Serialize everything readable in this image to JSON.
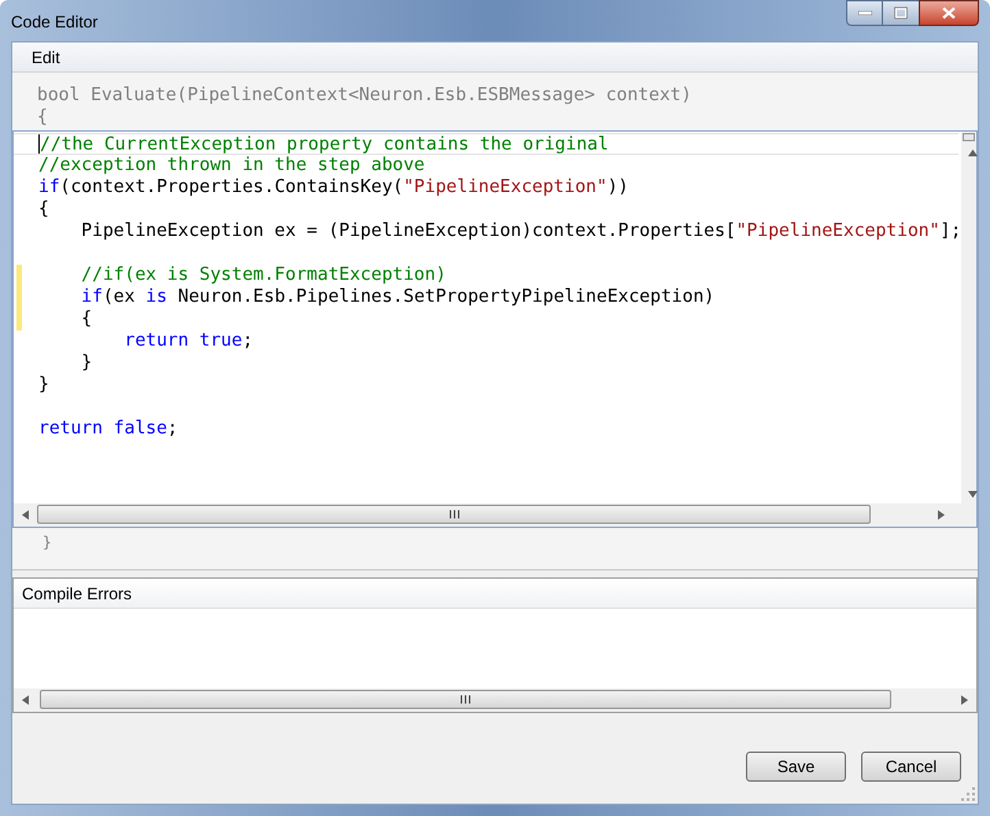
{
  "window": {
    "title": "Code Editor"
  },
  "menu": [
    {
      "label": "Edit"
    }
  ],
  "header_lines": [
    "bool Evaluate(PipelineContext<Neuron.Esb.ESBMessage> context)",
    "{"
  ],
  "code_lines": [
    {
      "current": true,
      "changed": false,
      "tokens": [
        {
          "kind": "comment",
          "text": "//the CurrentException property contains the original"
        }
      ]
    },
    {
      "current": false,
      "changed": false,
      "tokens": [
        {
          "kind": "comment",
          "text": "//exception thrown in the step above"
        }
      ]
    },
    {
      "current": false,
      "changed": false,
      "tokens": [
        {
          "kind": "keyword",
          "text": "if"
        },
        {
          "kind": "plain",
          "text": "(context.Properties.ContainsKey("
        },
        {
          "kind": "string",
          "text": "\"PipelineException\""
        },
        {
          "kind": "plain",
          "text": "))"
        }
      ]
    },
    {
      "current": false,
      "changed": false,
      "tokens": [
        {
          "kind": "plain",
          "text": "{"
        }
      ]
    },
    {
      "current": false,
      "changed": false,
      "tokens": [
        {
          "kind": "plain",
          "text": "    PipelineException ex = (PipelineException)context.Properties["
        },
        {
          "kind": "string",
          "text": "\"PipelineException\""
        },
        {
          "kind": "plain",
          "text": "];"
        }
      ]
    },
    {
      "current": false,
      "changed": false
    },
    {
      "current": false,
      "changed": true,
      "tokens": [
        {
          "kind": "comment",
          "text": "    //if(ex is System.FormatException)"
        }
      ]
    },
    {
      "current": false,
      "changed": true,
      "tokens": [
        {
          "kind": "keyword",
          "text": "    if"
        },
        {
          "kind": "plain",
          "text": "(ex "
        },
        {
          "kind": "keyword",
          "text": "is"
        },
        {
          "kind": "plain",
          "text": " Neuron.Esb.Pipelines.SetPropertyPipelineException)"
        }
      ]
    },
    {
      "current": false,
      "changed": true,
      "tokens": [
        {
          "kind": "plain",
          "text": "    {"
        }
      ]
    },
    {
      "current": false,
      "changed": false,
      "tokens": [
        {
          "kind": "keyword",
          "text": "        return true"
        },
        {
          "kind": "plain",
          "text": ";"
        }
      ]
    },
    {
      "current": false,
      "changed": false,
      "tokens": [
        {
          "kind": "plain",
          "text": "    }"
        }
      ]
    },
    {
      "current": false,
      "changed": false,
      "tokens": [
        {
          "kind": "plain",
          "text": "}"
        }
      ]
    },
    {
      "current": false,
      "changed": false
    },
    {
      "current": false,
      "changed": false,
      "tokens": [
        {
          "kind": "keyword",
          "text": "return false"
        },
        {
          "kind": "plain",
          "text": ";"
        }
      ]
    }
  ],
  "footer_lines": [
    "}"
  ],
  "errors_panel": {
    "column": "Compile Errors"
  },
  "buttons": [
    {
      "label": "Save"
    },
    {
      "label": "Cancel"
    }
  ]
}
